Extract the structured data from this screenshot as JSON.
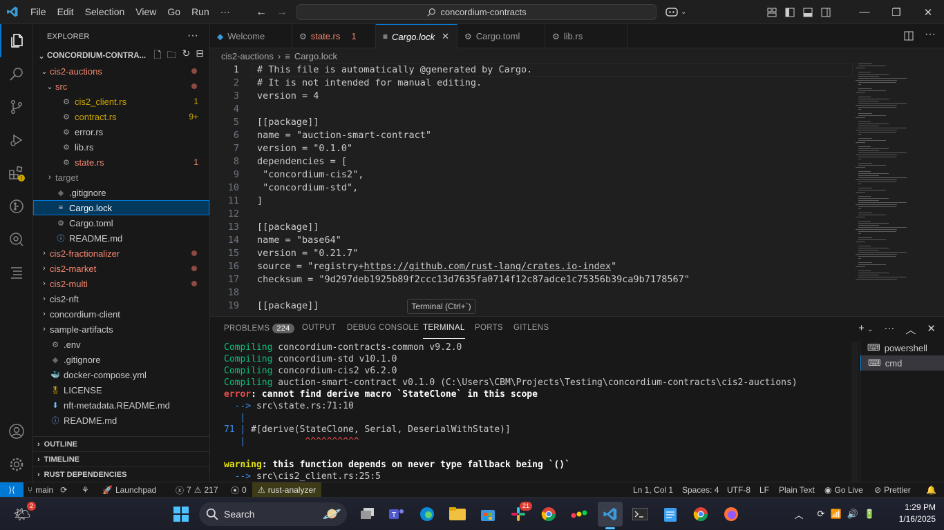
{
  "titlebar": {
    "menu": [
      "File",
      "Edit",
      "Selection",
      "View",
      "Go",
      "Run",
      "···"
    ],
    "search": "concordium-contracts"
  },
  "sidebar": {
    "title": "EXPLORER",
    "root": "CONCORDIUM-CONTRA...",
    "tree": [
      {
        "label": "cis2-auctions",
        "depth": 1,
        "type": "folder-open",
        "color": "#f48771",
        "dot": true
      },
      {
        "label": "src",
        "depth": 2,
        "type": "folder-open",
        "color": "#f48771",
        "dot": true
      },
      {
        "label": "cis2_client.rs",
        "depth": 3,
        "type": "rust",
        "color": "#cca700",
        "badge": "1"
      },
      {
        "label": "contract.rs",
        "depth": 3,
        "type": "rust",
        "color": "#cca700",
        "badge": "9+"
      },
      {
        "label": "error.rs",
        "depth": 3,
        "type": "rust",
        "color": "#cccccc"
      },
      {
        "label": "lib.rs",
        "depth": 3,
        "type": "rust",
        "color": "#cccccc"
      },
      {
        "label": "state.rs",
        "depth": 3,
        "type": "rust",
        "color": "#f48771",
        "badge": "1"
      },
      {
        "label": "target",
        "depth": 2,
        "type": "folder",
        "color": "#8c8c8c"
      },
      {
        "label": ".gitignore",
        "depth": 2,
        "type": "git",
        "color": "#cccccc"
      },
      {
        "label": "Cargo.lock",
        "depth": 2,
        "type": "lock",
        "color": "#ffffff",
        "selected": true
      },
      {
        "label": "Cargo.toml",
        "depth": 2,
        "type": "gear",
        "color": "#cccccc"
      },
      {
        "label": "README.md",
        "depth": 2,
        "type": "info",
        "color": "#cccccc"
      },
      {
        "label": "cis2-fractionalizer",
        "depth": 1,
        "type": "folder",
        "color": "#f48771",
        "dot": true
      },
      {
        "label": "cis2-market",
        "depth": 1,
        "type": "folder",
        "color": "#f48771",
        "dot": true
      },
      {
        "label": "cis2-multi",
        "depth": 1,
        "type": "folder",
        "color": "#f48771",
        "dot": true
      },
      {
        "label": "cis2-nft",
        "depth": 1,
        "type": "folder",
        "color": "#cccccc"
      },
      {
        "label": "concordium-client",
        "depth": 1,
        "type": "folder",
        "color": "#cccccc"
      },
      {
        "label": "sample-artifacts",
        "depth": 1,
        "type": "folder",
        "color": "#cccccc"
      },
      {
        "label": ".env",
        "depth": 1,
        "type": "gear",
        "color": "#cccccc"
      },
      {
        "label": ".gitignore",
        "depth": 1,
        "type": "git",
        "color": "#cccccc"
      },
      {
        "label": "docker-compose.yml",
        "depth": 1,
        "type": "docker",
        "color": "#cccccc"
      },
      {
        "label": "LICENSE",
        "depth": 1,
        "type": "license",
        "color": "#cccccc"
      },
      {
        "label": "nft-metadata.README.md",
        "depth": 1,
        "type": "download",
        "color": "#cccccc"
      },
      {
        "label": "README.md",
        "depth": 1,
        "type": "info",
        "color": "#cccccc"
      }
    ],
    "sections": [
      "OUTLINE",
      "TIMELINE",
      "RUST DEPENDENCIES"
    ]
  },
  "tabs": [
    {
      "label": "Welcome",
      "icon": "vscode"
    },
    {
      "label": "state.rs",
      "badge": "1",
      "icon": "rust",
      "color": "#f48771"
    },
    {
      "label": "Cargo.lock",
      "icon": "lock",
      "active": true
    },
    {
      "label": "Cargo.toml",
      "icon": "gear"
    },
    {
      "label": "lib.rs",
      "icon": "rust"
    }
  ],
  "breadcrumb": [
    "cis2-auctions",
    "Cargo.lock"
  ],
  "editor": {
    "lines": [
      {
        "n": "1",
        "t": "# This file is automatically @generated by Cargo."
      },
      {
        "n": "2",
        "t": "# It is not intended for manual editing."
      },
      {
        "n": "3",
        "t": "version = 4"
      },
      {
        "n": "4",
        "t": ""
      },
      {
        "n": "5",
        "t": "[[package]]"
      },
      {
        "n": "6",
        "t": "name = \"auction-smart-contract\""
      },
      {
        "n": "7",
        "t": "version = \"0.1.0\""
      },
      {
        "n": "8",
        "t": "dependencies = ["
      },
      {
        "n": "9",
        "t": " \"concordium-cis2\","
      },
      {
        "n": "10",
        "t": " \"concordium-std\","
      },
      {
        "n": "11",
        "t": "]"
      },
      {
        "n": "12",
        "t": ""
      },
      {
        "n": "13",
        "t": "[[package]]"
      },
      {
        "n": "14",
        "t": "name = \"base64\""
      },
      {
        "n": "15",
        "t": "version = \"0.21.7\""
      },
      {
        "n": "16",
        "t": "source = \"registry+https://github.com/rust-lang/crates.io-index\""
      },
      {
        "n": "17",
        "t": "checksum = \"9d297deb1925b89f2ccc13d7635fa0714f12c87adce1c75356b39ca9b7178567\""
      },
      {
        "n": "18",
        "t": ""
      },
      {
        "n": "19",
        "t": "[[package]]"
      }
    ],
    "tooltip": "Terminal (Ctrl+`)"
  },
  "panel": {
    "tabs": [
      "PROBLEMS",
      "OUTPUT",
      "DEBUG CONSOLE",
      "TERMINAL",
      "PORTS",
      "GITLENS"
    ],
    "problems_count": "224",
    "terminals": [
      "powershell",
      "cmd"
    ],
    "terminal": {
      "compiling_word": "Compiling",
      "c1": " concordium-contracts-common v9.2.0",
      "c2": " concordium-std v10.1.0",
      "c3": " concordium-cis2 v6.2.0",
      "c4": " auction-smart-contract v0.1.0 (C:\\Users\\CBM\\Projects\\Testing\\concordium-contracts\\cis2-auctions)",
      "error_word": "error",
      "error_msg": ": cannot find derive macro `StateClone` in this scope",
      "arrow1": "  -->",
      "loc1": " src\\state.rs:71:10",
      "pipe": "   |",
      "ln71": "71",
      "code71": " #[derive(StateClone, Serial, DeserialWithState)]",
      "carets": "           ^^^^^^^^^^",
      "warning_word": "warning",
      "warning_msg": ": this function depends on never type fallback being `()`",
      "arrow2": "  -->",
      "loc2": " src\\cis2_client.rs:25:5"
    }
  },
  "statusbar": {
    "branch": "main",
    "launchpad": "Launchpad",
    "errors": "7",
    "warnings": "217",
    "ports": "0",
    "rust_analyzer": "rust-analyzer",
    "position": "Ln 1, Col 1",
    "spaces": "Spaces: 4",
    "encoding": "UTF-8",
    "eol": "LF",
    "language": "Plain Text",
    "golive": "Go Live",
    "prettier": "Prettier"
  },
  "taskbar": {
    "search": "Search",
    "time": "1:29 PM",
    "date": "1/16/2025",
    "weather_badge": "2",
    "slack_badge": "21"
  }
}
